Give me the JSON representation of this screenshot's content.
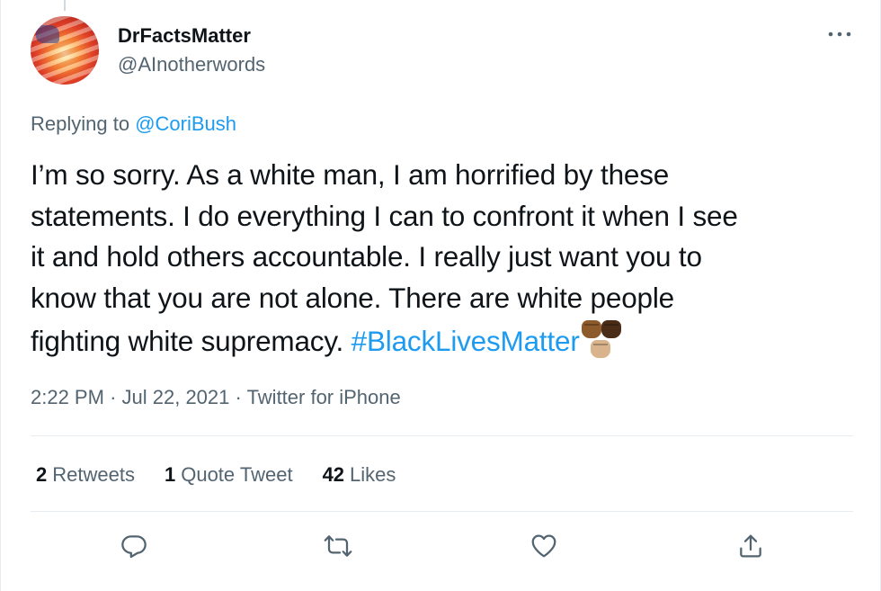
{
  "author": {
    "display_name": "DrFactsMatter",
    "handle": "@AInotherwords",
    "avatar_icon": "flag-sunset-avatar"
  },
  "reply": {
    "prefix": "Replying to",
    "to": "@CoriBush"
  },
  "tweet": {
    "line1": "I’m so sorry. As a white man, I am horrified by these",
    "line2": "statements. I do everything I can to confront it when I see",
    "line3": "it and hold others accountable. I really just want you to",
    "line4": "know that you are not alone. There are white people",
    "line5_text": "fighting white supremacy.",
    "hashtag": "#BlackLivesMatter",
    "emoji_icon": "raised-fists-mixed-skin-tones"
  },
  "meta": {
    "time": "2:22 PM",
    "separator": "·",
    "date": "Jul 22, 2021",
    "source": "Twitter for iPhone"
  },
  "stats": {
    "retweets_count": "2",
    "retweets_label": "Retweets",
    "quotes_count": "1",
    "quotes_label": "Quote Tweet",
    "likes_count": "42",
    "likes_label": "Likes"
  },
  "actions": {
    "reply_icon": "reply-icon",
    "retweet_icon": "retweet-icon",
    "like_icon": "heart-icon",
    "share_icon": "share-icon",
    "more_icon": "more-dots-icon"
  },
  "colors": {
    "accent": "#1d9bf0",
    "secondary_text": "#536471",
    "primary_text": "#0f1419",
    "divider": "#e6ecf0"
  }
}
